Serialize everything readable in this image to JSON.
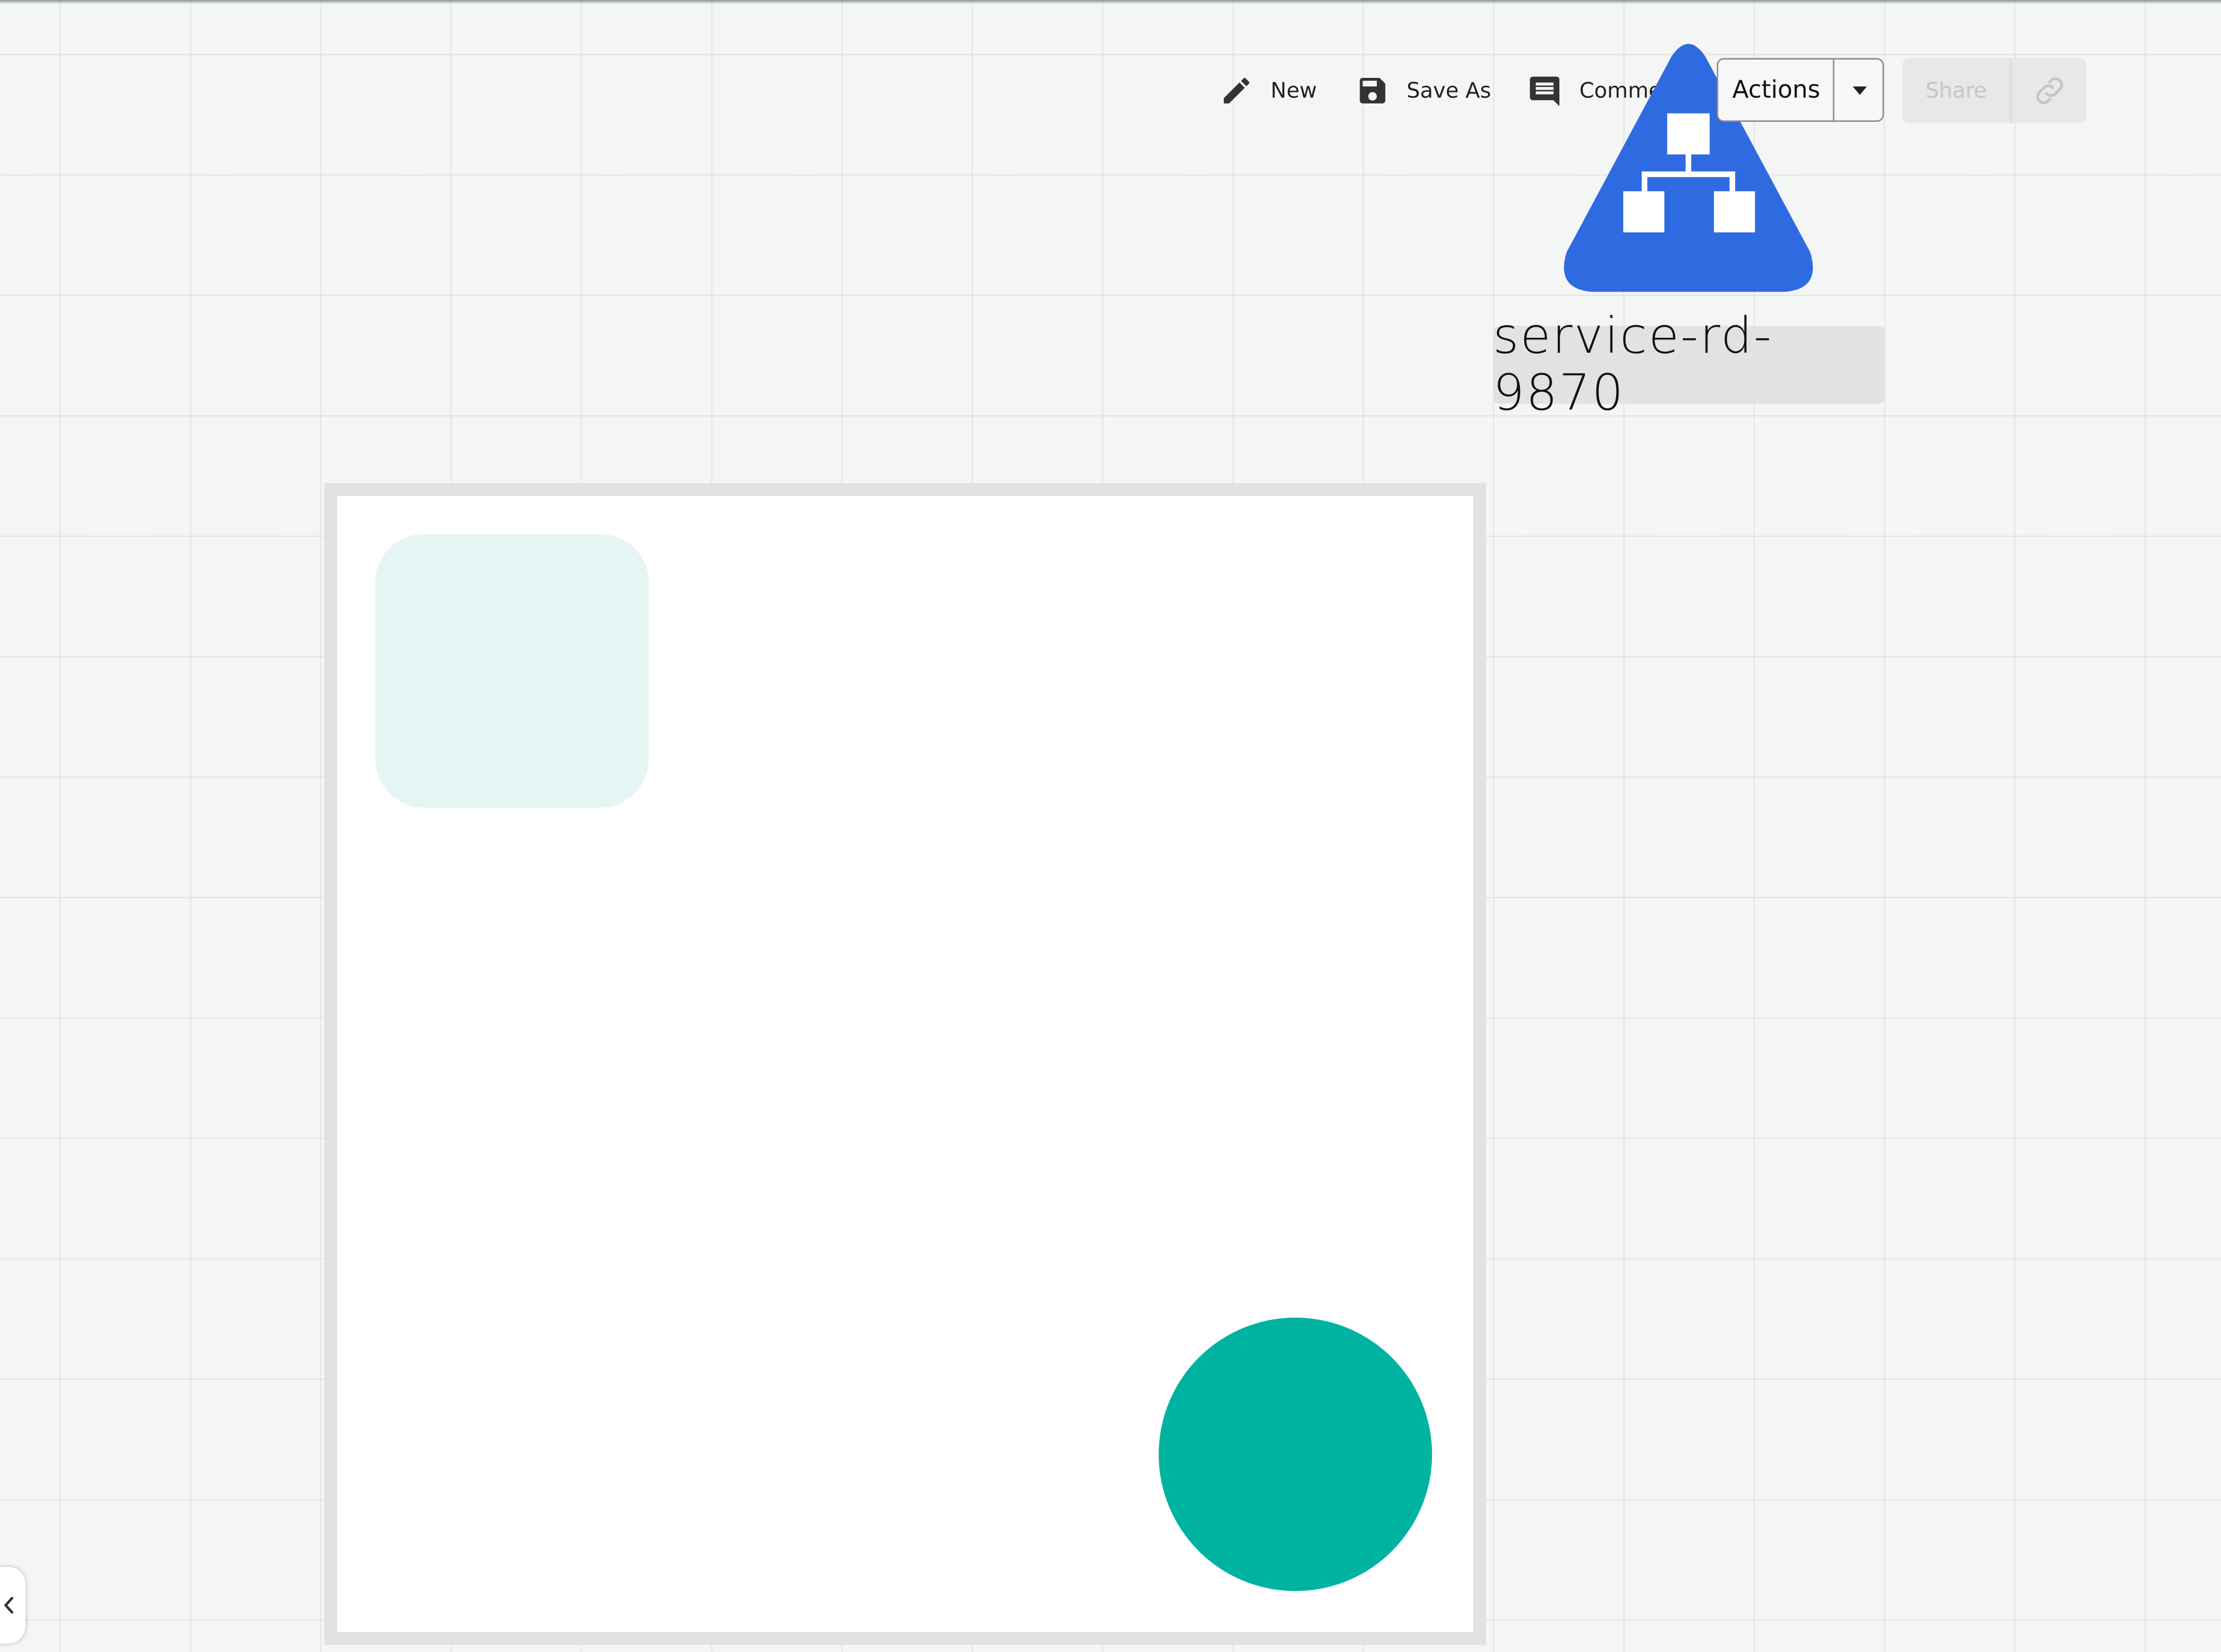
{
  "toolbar": {
    "new_label": "New",
    "save_as_label": "Save As",
    "comments_label": "Comments",
    "actions_label": "Actions",
    "share_label": "Share"
  },
  "node": {
    "label": "service-rd-9870",
    "icon": "hierarchy-icon",
    "color": "#2f6be0"
  },
  "canvas": {
    "tile_color": "#e4f5f3",
    "dot_color": "#00b3a1",
    "frame_color": "#e1e3e2"
  },
  "icons": {
    "new": "pencil-icon",
    "save_as": "floppy-disk-icon",
    "comments": "comment-icon",
    "actions_dropdown": "caret-down-icon",
    "share_link": "link-icon",
    "collapse": "chevron-left-icon"
  }
}
